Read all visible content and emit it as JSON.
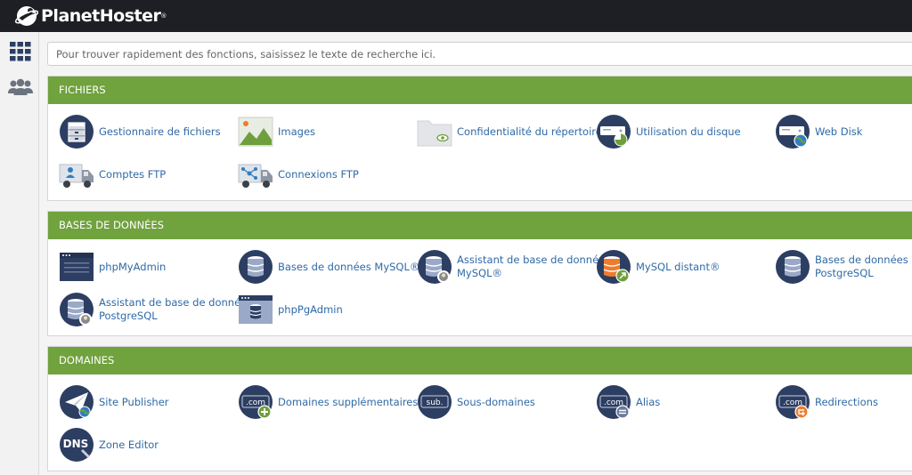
{
  "brand": {
    "name": "PlanetHoster",
    "reg": "®"
  },
  "search": {
    "placeholder": "Pour trouver rapidement des fonctions, saisissez le texte de recherche ici."
  },
  "sections": {
    "fichiers": {
      "title": "FICHIERS",
      "items": [
        {
          "label": "Gestionnaire de fichiers",
          "icon": "file-manager-icon"
        },
        {
          "label": "Images",
          "icon": "images-icon"
        },
        {
          "label": "Confidentialité du répertoire",
          "icon": "folder-privacy-icon"
        },
        {
          "label": "Utilisation du disque",
          "icon": "disk-usage-icon"
        },
        {
          "label": "Web Disk",
          "icon": "web-disk-icon"
        },
        {
          "label": "Comptes FTP",
          "icon": "ftp-accounts-icon"
        },
        {
          "label": "Connexions FTP",
          "icon": "ftp-connections-icon"
        }
      ]
    },
    "bases": {
      "title": "BASES DE DONNÉES",
      "items": [
        {
          "label": "phpMyAdmin",
          "icon": "phpmyadmin-icon"
        },
        {
          "label": "Bases de données MySQL®",
          "icon": "mysql-databases-icon"
        },
        {
          "label": "Assistant de base de données MySQL®",
          "line1": "Assistant de base de données",
          "line2": "MySQL®",
          "icon": "mysql-wizard-icon"
        },
        {
          "label": "MySQL distant®",
          "icon": "remote-mysql-icon"
        },
        {
          "label": "Bases de données PostgreSQL",
          "line1": "Bases de données",
          "line2": "PostgreSQL",
          "icon": "postgresql-databases-icon"
        },
        {
          "label": "Assistant de base de données PostgreSQL",
          "line1": "Assistant de base de données",
          "line2": "PostgreSQL",
          "icon": "postgresql-wizard-icon"
        },
        {
          "label": "phpPgAdmin",
          "icon": "phppgadmin-icon"
        }
      ]
    },
    "domaines": {
      "title": "DOMAINES",
      "items": [
        {
          "label": "Site Publisher",
          "icon": "site-publisher-icon"
        },
        {
          "label": "Domaines supplémentaires",
          "icon": "addon-domains-icon",
          "tag": ".com"
        },
        {
          "label": "Sous-domaines",
          "icon": "subdomains-icon",
          "tag": "sub."
        },
        {
          "label": "Alias",
          "icon": "aliases-icon",
          "tag": ".com"
        },
        {
          "label": "Redirections",
          "icon": "redirects-icon",
          "tag": ".com"
        },
        {
          "label": "Zone Editor",
          "icon": "zone-editor-icon",
          "tag": "DNS"
        }
      ]
    }
  },
  "colors": {
    "topbar": "#1d1f24",
    "header_green": "#70a23e",
    "link": "#2f6aa6",
    "icon_navy": "#2d3e63"
  }
}
